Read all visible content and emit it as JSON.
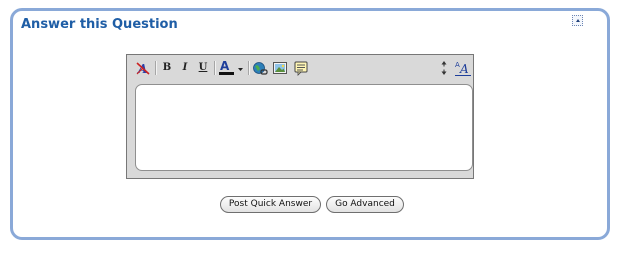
{
  "panel": {
    "title": "Answer this Question"
  },
  "editor": {
    "toolbar": {
      "bold": "B",
      "italic": "I",
      "underline": "U",
      "font_color_letter": "A",
      "font_size_label": "A"
    },
    "body_text": ""
  },
  "buttons": {
    "post_label": "Post Quick Answer",
    "advanced_label": "Go Advanced"
  },
  "colors": {
    "accent": "#1f5ea6",
    "panel_border": "#8aa9d8"
  }
}
